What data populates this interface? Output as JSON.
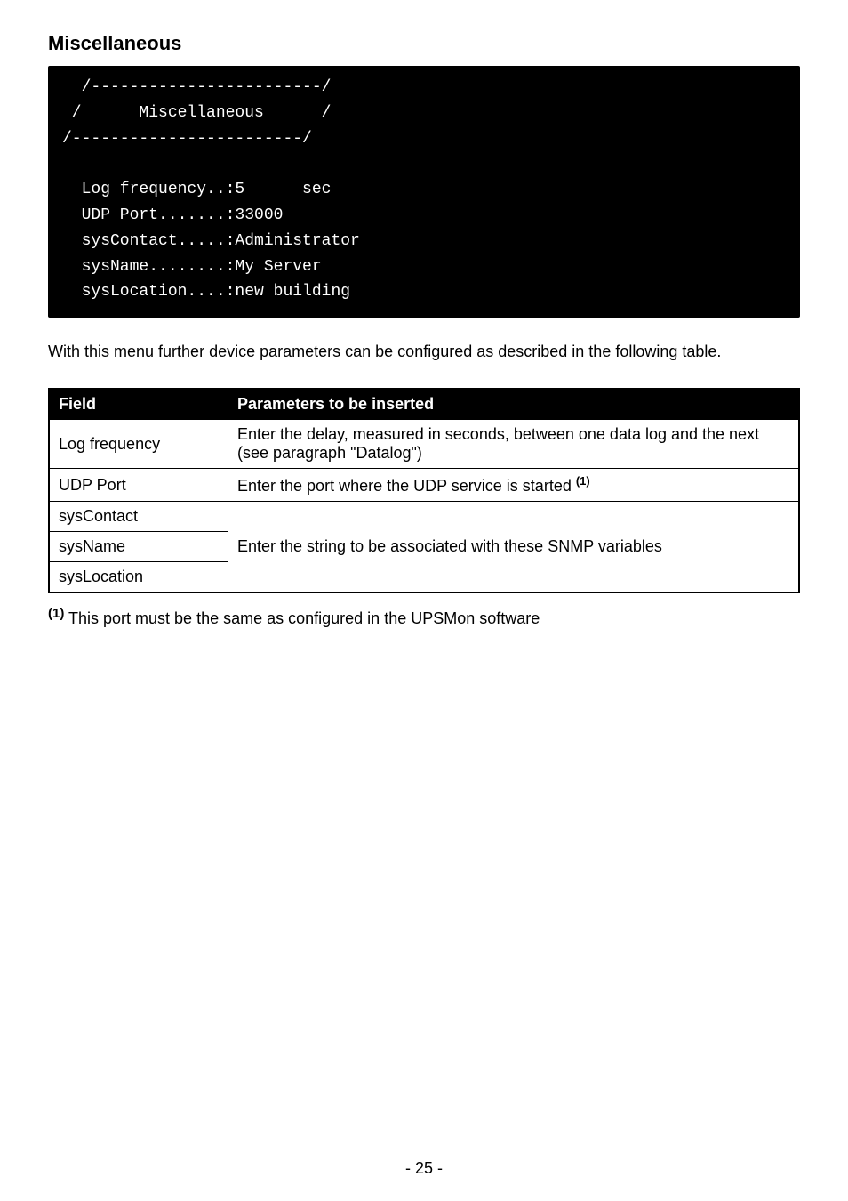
{
  "heading": "Miscellaneous",
  "terminal": "  /------------------------/\n /      Miscellaneous      /\n/------------------------/\n\n  Log frequency..:5      sec\n  UDP Port.......:33000\n  sysContact.....:Administrator\n  sysName........:My Server\n  sysLocation....:new building",
  "intro": "With this menu further device parameters can be configured as described in the following table.",
  "table": {
    "headers": {
      "field": "Field",
      "params": "Parameters to be inserted"
    },
    "rows": [
      {
        "field": "Log frequency",
        "params": "Enter the delay, measured in seconds, between one data log and the next (see paragraph \"Datalog\")"
      },
      {
        "field": "UDP Port",
        "params": "Enter the port where the UDP service is started ",
        "sup": "(1)"
      },
      {
        "field": "sysContact",
        "shared": "Enter the string to be associated with these SNMP variables"
      },
      {
        "field": "sysName"
      },
      {
        "field": "sysLocation"
      }
    ]
  },
  "footnote": {
    "sup": "(1)",
    "text": " This port must be the same as configured in the UPSMon software"
  },
  "page_number": "- 25 -"
}
